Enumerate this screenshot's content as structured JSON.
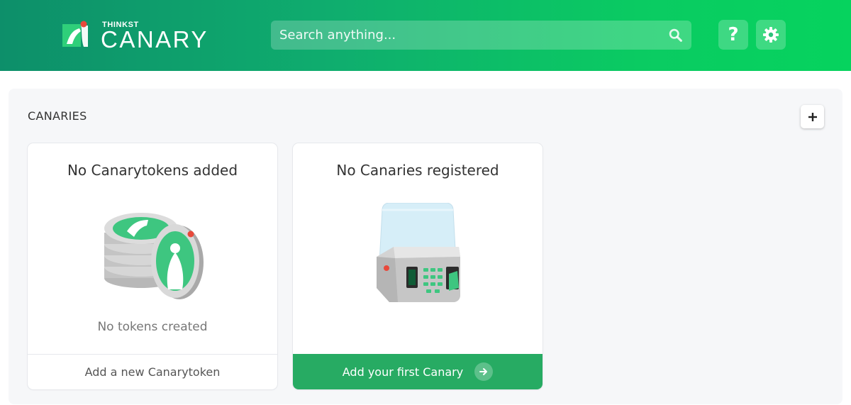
{
  "header": {
    "logo_small": "THINKST",
    "logo_big": "CANARY",
    "search_placeholder": "Search anything...",
    "help_label": "?",
    "colors": {
      "gradient_start": "#0d8f6a",
      "gradient_end": "#06d35e"
    }
  },
  "panel": {
    "title": "CANARIES",
    "add_label": "+"
  },
  "cards": {
    "tokens": {
      "title": "No Canarytokens added",
      "subtitle": "No tokens created",
      "footer": "Add a new Canarytoken",
      "icon": "canarytoken-coins-icon"
    },
    "canaries": {
      "title": "No Canaries registered",
      "footer": "Add your first Canary",
      "footer_color": "#27ab63",
      "icon": "canary-device-icon"
    }
  }
}
